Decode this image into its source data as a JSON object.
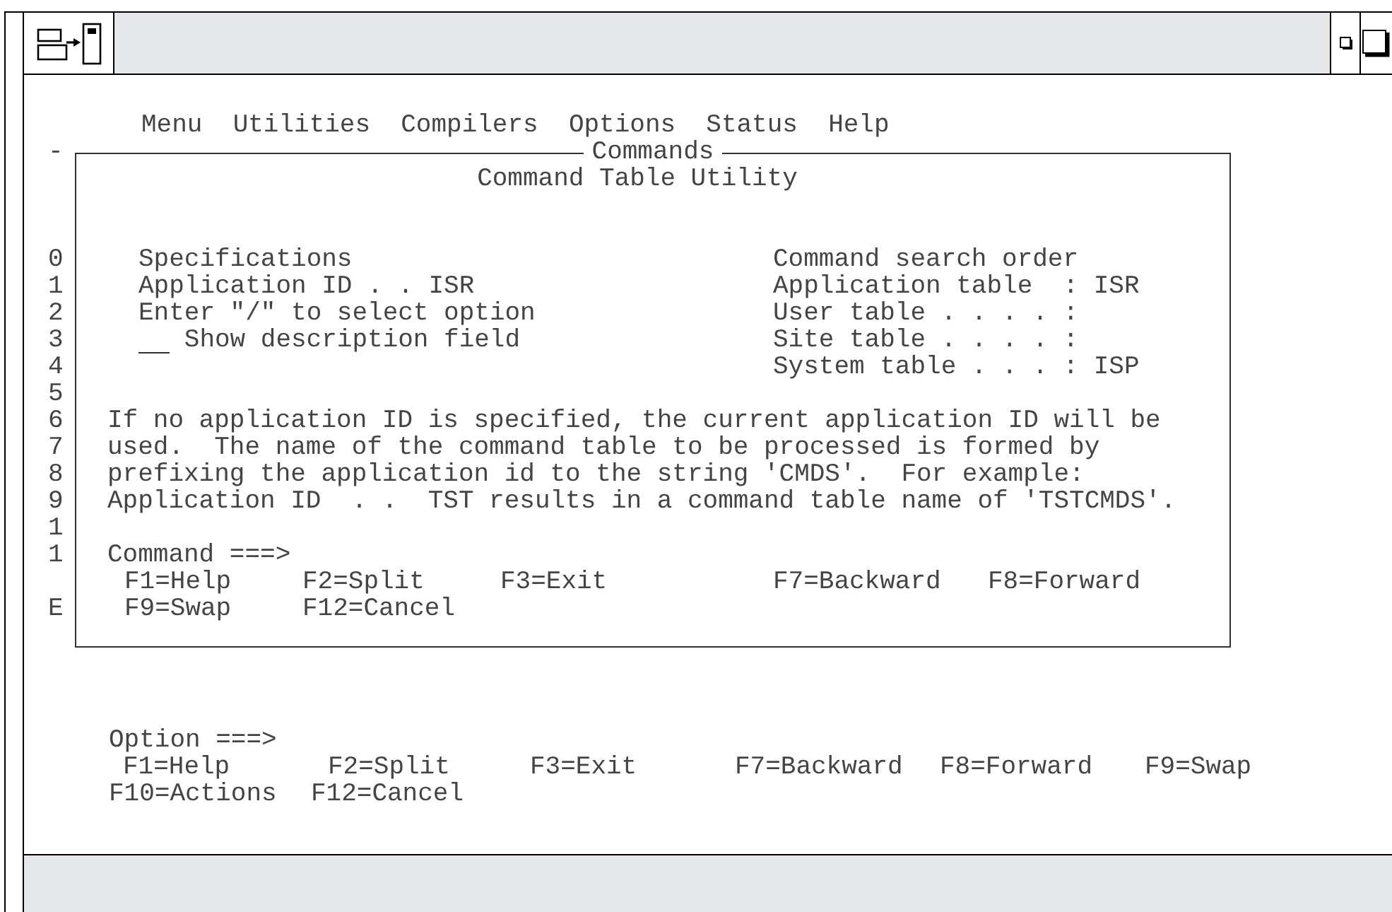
{
  "menu_bar": [
    "Menu",
    "Utilities",
    "Compilers",
    "Options",
    "Status",
    "Help"
  ],
  "dialog": {
    "rows": [
      {
        "kind": "title",
        "gutter": [
          "-"
        ],
        "text": "Commands"
      },
      {
        "kind": "subtitle",
        "text": "Command Table Utility"
      },
      {
        "kind": "blank"
      },
      {
        "kind": "blank"
      },
      {
        "kind": "pair",
        "gutter": [
          "0"
        ],
        "left": "Specifications",
        "right": "Command search order"
      },
      {
        "kind": "pair",
        "gutter": [
          "1"
        ],
        "left": "Application ID . . ISR",
        "right": "Application table  : ISR"
      },
      {
        "kind": "pair",
        "gutter": [
          "2"
        ],
        "left": "Enter \"/\" to select option",
        "right": "User table . . . . :"
      },
      {
        "kind": "option",
        "gutter": [
          "3"
        ],
        "checked": false,
        "left": "Show description field",
        "right": "Site table . . . . :"
      },
      {
        "kind": "pair",
        "gutter": [
          "4"
        ],
        "right": "System table . . . : ISP"
      },
      {
        "kind": "blank",
        "gutter": [
          "5"
        ]
      },
      {
        "kind": "paragraph",
        "gutter": [
          "6",
          "7",
          "8",
          "9"
        ],
        "text": "If no application ID is specified, the current application ID will be used.  The name of the command table to be processed is formed by prefixing the application id to the string 'CMDS'.  For example: Application ID  . .  TST results in a command table name of 'TSTCMDS'."
      },
      {
        "kind": "blank",
        "gutter": [
          "1"
        ]
      },
      {
        "kind": "prompt",
        "gutter": [
          "1"
        ],
        "text": "Command ===>"
      },
      {
        "kind": "fkeys",
        "keys": [
          "F1=Help",
          "F2=Split",
          "F3=Exit",
          "F7=Backward",
          "F8=Forward"
        ]
      },
      {
        "kind": "fkeys",
        "gutter": [
          "E"
        ],
        "keys": [
          "F9=Swap",
          "F12=Cancel"
        ]
      }
    ]
  },
  "prompt": "Option ===>",
  "function_keys": [
    [
      "F1=Help",
      "F2=Split",
      "F3=Exit",
      "F7=Backward",
      "F8=Forward",
      "F9=Swap"
    ],
    [
      "F10=Actions",
      "F12=Cancel"
    ]
  ]
}
